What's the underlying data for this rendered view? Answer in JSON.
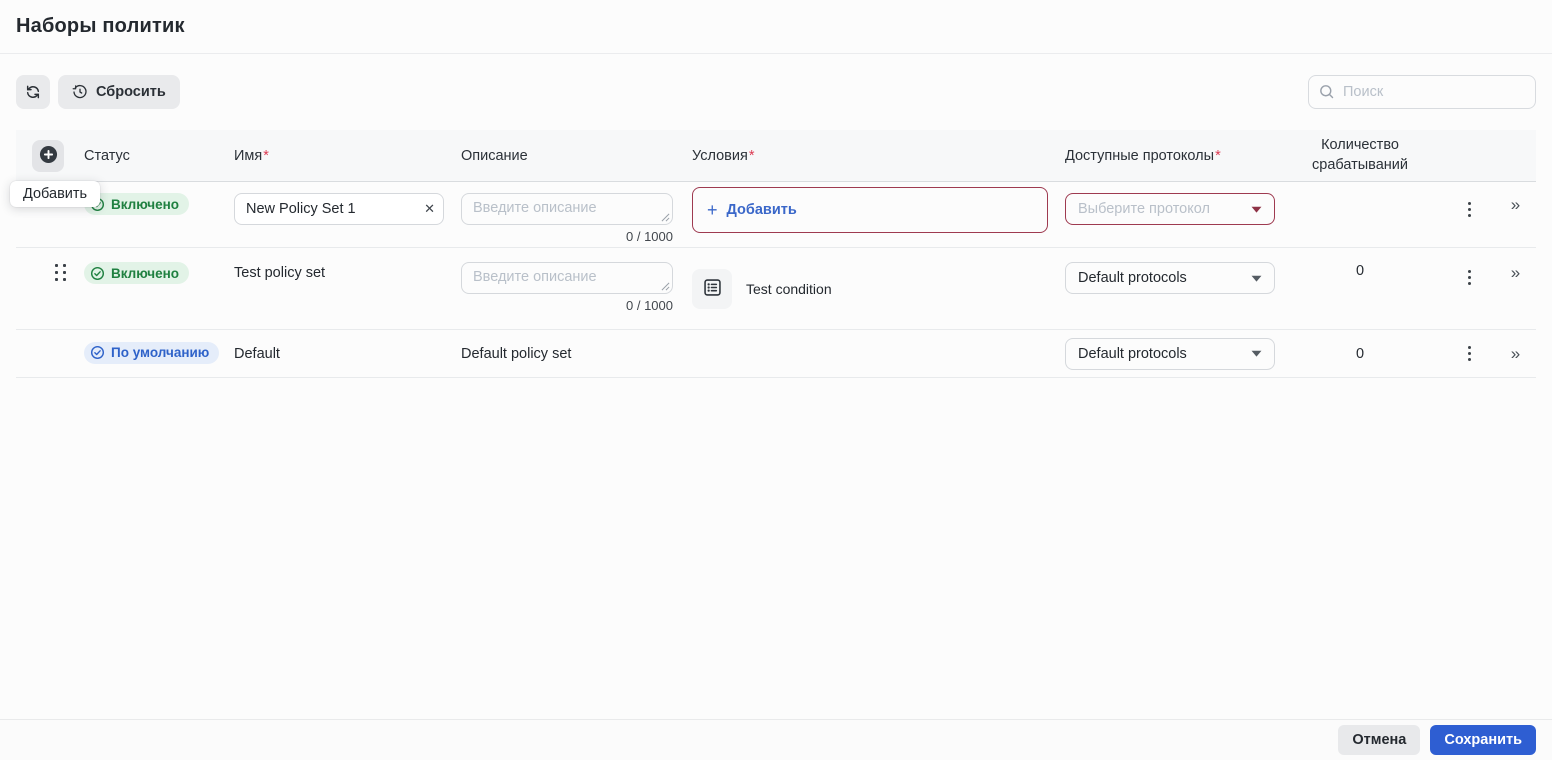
{
  "page": {
    "title": "Наборы политик"
  },
  "toolbar": {
    "reset_label": "Сбросить",
    "search_placeholder": "Поиск"
  },
  "table": {
    "add_tooltip": "Добавить",
    "required_mark": "*",
    "columns": [
      {
        "label": "Статус",
        "required": false
      },
      {
        "label": "Имя",
        "required": true
      },
      {
        "label": "Описание",
        "required": false
      },
      {
        "label": "Условия",
        "required": true
      },
      {
        "label": "Доступные протоколы",
        "required": true
      },
      {
        "label": "Количество срабатываний",
        "required": false
      }
    ]
  },
  "rows": [
    {
      "status": "Включено",
      "status_type": "enabled",
      "name_value": "New Policy Set 1",
      "description_placeholder": "Введите описание",
      "description_counter": "0 / 1000",
      "conditions_add_label": "Добавить",
      "protocols_placeholder": "Выберите протокол",
      "trigger_count": ""
    },
    {
      "status": "Включено",
      "status_type": "enabled",
      "name_text": "Test policy set",
      "description_placeholder": "Введите описание",
      "description_counter": "0 / 1000",
      "condition_name": "Test condition",
      "protocols_value": "Default protocols",
      "trigger_count": "0"
    },
    {
      "status": "По умолчанию",
      "status_type": "default",
      "name_text": "Default",
      "description_text": "Default policy set",
      "protocols_value": "Default protocols",
      "trigger_count": "0"
    }
  ],
  "footer": {
    "cancel_label": "Отмена",
    "save_label": "Сохранить"
  },
  "icons": {
    "plus": "+",
    "clear": "✕",
    "expand": "»"
  },
  "colors": {
    "save_blue": "#2e5ed2",
    "link_blue": "#3a67c9",
    "error_border": "#9e3a50",
    "required_red": "#dc3a52",
    "badge_green_bg": "#e2f3e7",
    "badge_green_text": "#1f8040",
    "badge_blue_bg": "#e5edfa",
    "badge_blue_text": "#2e62c9"
  }
}
